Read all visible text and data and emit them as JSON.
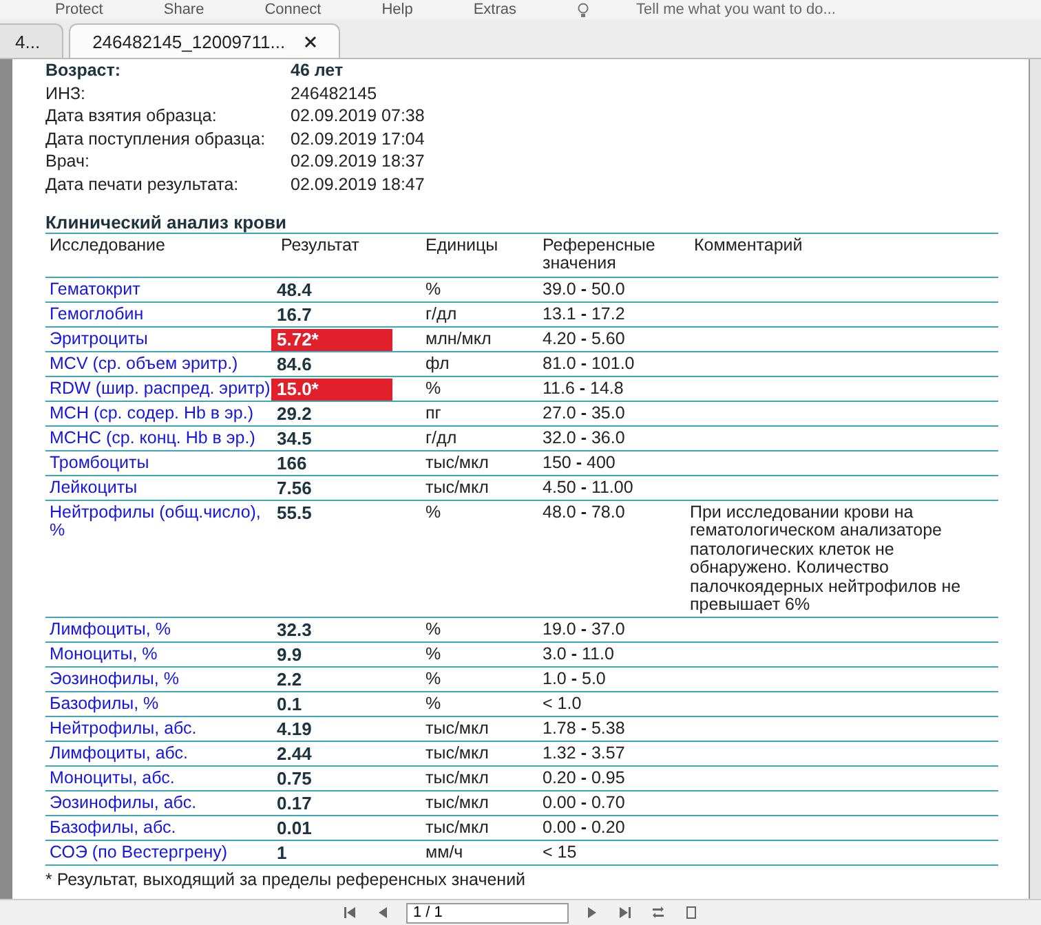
{
  "menu": [
    "Protect",
    "Share",
    "Connect",
    "Help",
    "Extras"
  ],
  "tell_me": {
    "placeholder": "Tell me what you want to do..."
  },
  "tabs": [
    {
      "label": "4...",
      "selected": false
    },
    {
      "label": "246482145_12009711...",
      "selected": true
    }
  ],
  "patient": [
    {
      "label": "Возраст:",
      "value": "46 лет",
      "bold": true
    },
    {
      "label": "ИНЗ:",
      "value": "246482145",
      "bold": false
    },
    {
      "label": "Дата взятия образца:",
      "value": "02.09.2019 07:38",
      "bold": false
    },
    {
      "label": "Дата поступления образца:",
      "value": "02.09.2019 17:04",
      "bold": false
    },
    {
      "label": "Врач:",
      "value": "02.09.2019 18:37",
      "bold": false
    },
    {
      "label": "Дата печати результата:",
      "value": "02.09.2019 18:47",
      "bold": false
    }
  ],
  "section_title": "Клинический анализ крови",
  "table": {
    "columns": [
      "Исследование",
      "Результат",
      "Единицы",
      "Референсные значения",
      "Комментарий"
    ],
    "rows": [
      {
        "name": "Гематокрит",
        "result": "48.4",
        "flagged": false,
        "units": "%",
        "reference": "39.0 **-** 50.0"
      },
      {
        "name": "Гемоглобин",
        "result": "16.7",
        "flagged": false,
        "units": "г/дл",
        "reference": "13.1 **-** 17.2"
      },
      {
        "name": "Эритроциты",
        "result": "5.72*",
        "flagged": true,
        "units": "млн/мкл",
        "reference": "4.20 **-** 5.60"
      },
      {
        "name": "MCV (ср. объем эритр.)",
        "result": "84.6",
        "flagged": false,
        "units": "фл",
        "reference": "81.0 **-** 101.0"
      },
      {
        "name": "RDW (шир. распред. эритр)",
        "result": "15.0*",
        "flagged": true,
        "units": "%",
        "reference": "11.6 **-** 14.8"
      },
      {
        "name": "MCH (ср. содер. Hb в эр.)",
        "result": "29.2",
        "flagged": false,
        "units": "пг",
        "reference": "27.0 **-** 35.0"
      },
      {
        "name": "MCHC (ср. конц. Hb в эр.)",
        "result": "34.5",
        "flagged": false,
        "units": "г/дл",
        "reference": "32.0 **-** 36.0"
      },
      {
        "name": "Тромбоциты",
        "result": "166",
        "flagged": false,
        "units": "тыс/мкл",
        "reference": "150 **-** 400"
      },
      {
        "name": "Лейкоциты",
        "result": "7.56",
        "flagged": false,
        "units": "тыс/мкл",
        "reference": "4.50 **-** 11.00"
      },
      {
        "name": "Нейтрофилы (общ.число), %",
        "result": "55.5",
        "flagged": false,
        "units": "%",
        "reference": "48.0 **-** 78.0",
        "comment": "При исследовании крови на гематологическом анализаторе патологических клеток не обнаружено. Количество палочкоядерных нейтрофилов не превышает 6%"
      },
      {
        "name": "Лимфоциты, %",
        "result": "32.3",
        "flagged": false,
        "units": "%",
        "reference": "19.0 **-** 37.0"
      },
      {
        "name": "Моноциты, %",
        "result": "9.9",
        "flagged": false,
        "units": "%",
        "reference": "3.0 **-** 11.0"
      },
      {
        "name": "Эозинофилы, %",
        "result": "2.2",
        "flagged": false,
        "units": "%",
        "reference": "1.0 **-** 5.0"
      },
      {
        "name": "Базофилы, %",
        "result": "0.1",
        "flagged": false,
        "units": "%",
        "reference": "< 1.0"
      },
      {
        "name": "Нейтрофилы, абс.",
        "result": "4.19",
        "flagged": false,
        "units": "тыс/мкл",
        "reference": "1.78 **-** 5.38"
      },
      {
        "name": "Лимфоциты, абс.",
        "result": "2.44",
        "flagged": false,
        "units": "тыс/мкл",
        "reference": "1.32 **-** 3.57"
      },
      {
        "name": "Моноциты, абс.",
        "result": "0.75",
        "flagged": false,
        "units": "тыс/мкл",
        "reference": "0.20 **-** 0.95"
      },
      {
        "name": "Эозинофилы, абс.",
        "result": "0.17",
        "flagged": false,
        "units": "тыс/мкл",
        "reference": "0.00 **-** 0.70"
      },
      {
        "name": "Базофилы, абс.",
        "result": "0.01",
        "flagged": false,
        "units": "тыс/мкл",
        "reference": "0.00 **-** 0.20"
      },
      {
        "name": "СОЭ (по Вестергрену)",
        "result": "1",
        "flagged": false,
        "units": "мм/ч",
        "reference": "< 15"
      }
    ]
  },
  "footnote": "* Результат, выходящий за пределы референсных значений",
  "pager": {
    "value": "1 / 1"
  }
}
